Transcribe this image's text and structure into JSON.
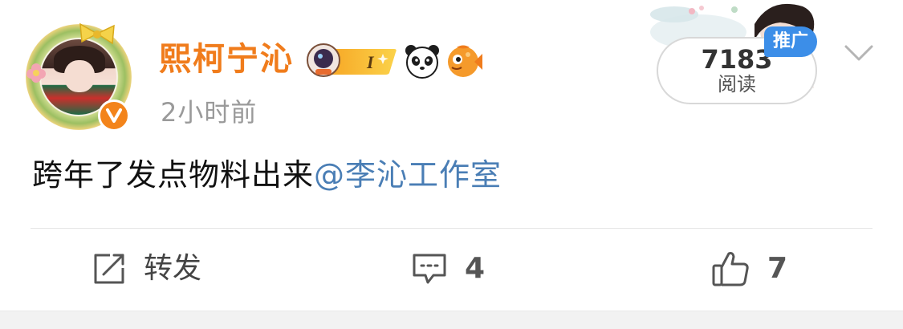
{
  "post": {
    "author": "熙柯宁沁",
    "time": "2小时前",
    "text": "跨年了发点物料出来",
    "mention": "@李沁工作室"
  },
  "stats": {
    "read_count": "7183",
    "read_label": "阅读",
    "promo_tag": "推广"
  },
  "badges": {
    "astro_badge_letter": "I"
  },
  "actions": {
    "repost_label": "转发",
    "comment_count": "4",
    "like_count": "7"
  },
  "icons": {
    "verified": "verified-v-icon",
    "repost": "share-icon",
    "comment": "comment-icon",
    "like": "thumbs-up-icon",
    "menu": "chevron-down-icon"
  },
  "colors": {
    "username": "#f07c1c",
    "mention": "#4a7eb5",
    "promo": "#3c8ee8",
    "verified": "#f3841b"
  }
}
